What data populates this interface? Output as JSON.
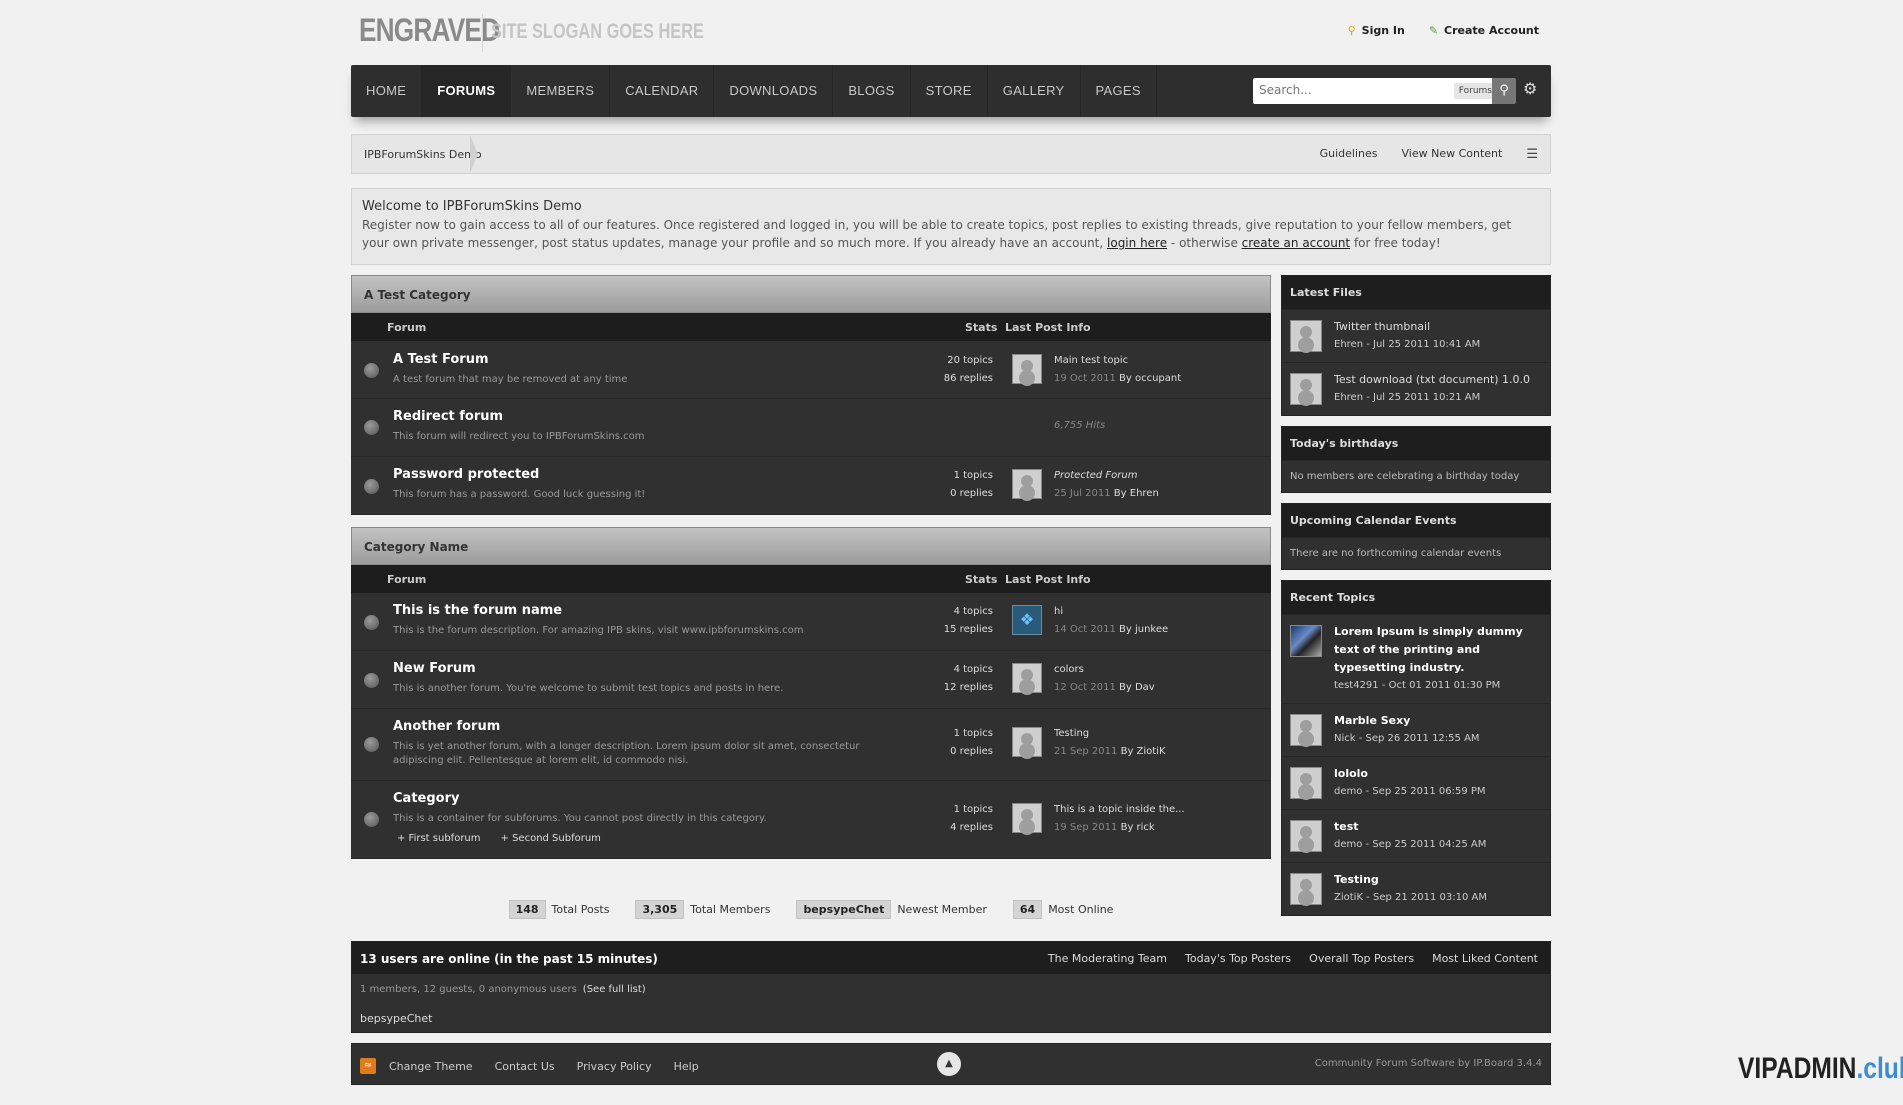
{
  "header": {
    "logo": "ENGRAVED",
    "slogan": "SITE SLOGAN GOES HERE",
    "sign_in": "Sign In",
    "create_account": "Create Account"
  },
  "nav": {
    "items": [
      "HOME",
      "FORUMS",
      "MEMBERS",
      "CALENDAR",
      "DOWNLOADS",
      "BLOGS",
      "STORE",
      "GALLERY",
      "PAGES"
    ],
    "active": "FORUMS",
    "search_placeholder": "Search...",
    "search_scope": "Forums"
  },
  "breadcrumb": {
    "home": "IPBForumSkins Demo",
    "links": [
      "Guidelines",
      "View New Content"
    ]
  },
  "welcome": {
    "title": "Welcome to IPBForumSkins Demo",
    "text_1": "Register now to gain access to all of our features. Once registered and logged in, you will be able to create topics, post replies to existing threads, give reputation to your fellow members, get your own private messenger, post status updates, manage your profile and so much more. If you already have an account, ",
    "login_link": "login here",
    "text_2": " - otherwise ",
    "create_link": "create an account",
    "text_3": " for free today!"
  },
  "columns": {
    "forum": "Forum",
    "stats": "Stats",
    "last_post": "Last Post Info"
  },
  "categories": [
    {
      "name": "A Test Category",
      "forums": [
        {
          "name": "A Test Forum",
          "desc": "A test forum that may be removed at any time",
          "topics": "20 topics",
          "replies": "86 replies",
          "last_title": "Main test topic",
          "last_date": "19 Oct 2011",
          "last_by": "By occupant"
        },
        {
          "name": "Redirect forum",
          "desc": "This forum will redirect you to IPBForumSkins.com",
          "hits": "6,755 Hits"
        },
        {
          "name": "Password protected",
          "desc": "This forum has a password. Good luck guessing it!",
          "topics": "1 topics",
          "replies": "0 replies",
          "last_title": "Protected Forum",
          "last_date": "25 Jul 2011",
          "last_by": "By Ehren"
        }
      ]
    },
    {
      "name": "Category Name",
      "forums": [
        {
          "name": "This is the forum name",
          "desc": "This is the forum description. For amazing IPB skins, visit www.ipbforumskins.com",
          "topics": "4 topics",
          "replies": "15 replies",
          "last_title": "hi",
          "last_date": "14 Oct 2011",
          "last_by": "By junkee"
        },
        {
          "name": "New Forum",
          "desc": "This is another forum. You're welcome to submit test topics and posts in here.",
          "topics": "4 topics",
          "replies": "12 replies",
          "last_title": "colors",
          "last_date": "12 Oct 2011",
          "last_by": "By Dav"
        },
        {
          "name": "Another forum",
          "desc_1": "This is yet another forum, with a longer description. Lorem ipsum dolor sit amet, consectetur",
          "desc_2": "adipiscing elit. Pellentesque at lorem elit, id commodo nisi.",
          "topics": "1 topics",
          "replies": "0 replies",
          "last_title": "Testing",
          "last_date": "21 Sep 2011",
          "last_by": "By ZiotiK"
        },
        {
          "name": "Category",
          "desc": "This is a container for subforums. You cannot post directly in this category.",
          "topics": "1 topics",
          "replies": "4 replies",
          "last_title": "This is a topic inside the...",
          "last_date": "19 Sep 2011",
          "last_by": "By rick",
          "subforums": [
            "+ First subforum",
            "+ Second Subforum"
          ]
        }
      ]
    }
  ],
  "sidebar": {
    "latest_files": {
      "title": "Latest Files",
      "items": [
        {
          "name": "Twitter thumbnail",
          "meta": "Ehren - Jul 25 2011 10:41 AM"
        },
        {
          "name": "Test download (txt document) 1.0.0",
          "meta": "Ehren - Jul 25 2011 10:21 AM"
        }
      ]
    },
    "birthdays": {
      "title": "Today's birthdays",
      "text": "No members are celebrating a birthday today"
    },
    "calendar": {
      "title": "Upcoming Calendar Events",
      "text": "There are no forthcoming calendar events"
    },
    "recent_topics": {
      "title": "Recent Topics",
      "items": [
        {
          "title": "Lorem Ipsum is simply dummy text of the printing and typesetting industry.",
          "meta": "test4291 - Oct 01 2011 01:30 PM"
        },
        {
          "title": "Marble Sexy",
          "meta": "Nick - Sep 26 2011 12:55 AM"
        },
        {
          "title": "lololo",
          "meta": "demo - Sep 25 2011 06:59 PM"
        },
        {
          "title": "test",
          "meta": "demo - Sep 25 2011 04:25 AM"
        },
        {
          "title": "Testing",
          "meta": "ZiotiK - Sep 21 2011 03:10 AM"
        }
      ]
    }
  },
  "stats": [
    {
      "value": "148",
      "label": "Total Posts"
    },
    {
      "value": "3,305",
      "label": "Total Members"
    },
    {
      "value": "bepsypeChet",
      "label": "Newest Member"
    },
    {
      "value": "64",
      "label": "Most Online"
    }
  ],
  "online": {
    "title": "13 users are online (in the past 15 minutes)",
    "links": [
      "The Moderating Team",
      "Today's Top Posters",
      "Overall Top Posters",
      "Most Liked Content"
    ],
    "counts": "1 members, 12 guests, 0 anonymous users",
    "full_list": "(See full list)",
    "member": "bepsypeChet"
  },
  "footer": {
    "links": [
      "Change Theme",
      "Contact Us",
      "Privacy Policy",
      "Help"
    ],
    "copyright": "Community Forum Software by IP.Board 3.4.4"
  },
  "watermark": {
    "main": "VIPADMIN",
    "accent": ".club"
  }
}
